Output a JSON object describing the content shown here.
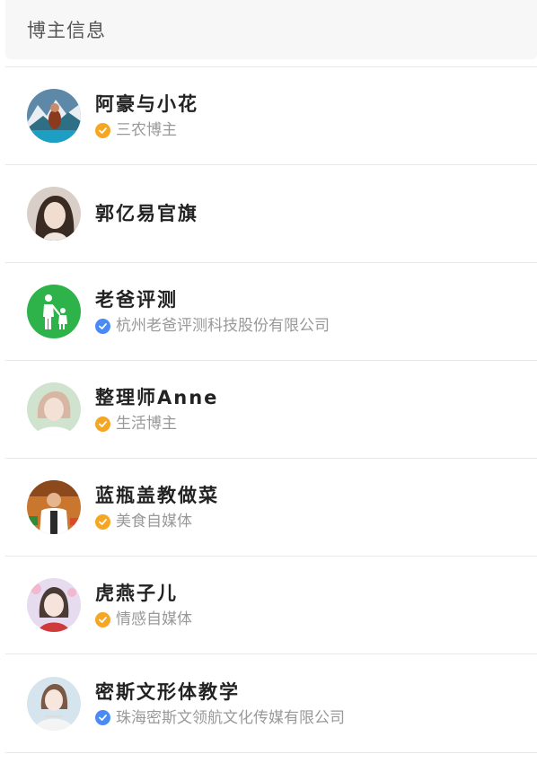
{
  "header": {
    "title": "博主信息"
  },
  "colors": {
    "badge_gold": "#f5a623",
    "badge_blue": "#4a8af4",
    "avatar_green": "#2db34a"
  },
  "bloggers": [
    {
      "name": "阿豪与小花",
      "description": "三农博主",
      "badge": "gold-check-icon"
    },
    {
      "name": "郭亿易官旗",
      "description": "",
      "badge": ""
    },
    {
      "name": "老爸评测",
      "description": "杭州老爸评测科技股份有限公司",
      "badge": "blue-check-icon"
    },
    {
      "name": "整理师Anne",
      "description": "生活博主",
      "badge": "gold-check-icon"
    },
    {
      "name": "蓝瓶盖教做菜",
      "description": "美食自媒体",
      "badge": "gold-check-icon"
    },
    {
      "name": "虎燕子儿",
      "description": "情感自媒体",
      "badge": "gold-check-icon"
    },
    {
      "name": "密斯文形体教学",
      "description": "珠海密斯文领航文化传媒有限公司",
      "badge": "blue-check-icon"
    }
  ]
}
